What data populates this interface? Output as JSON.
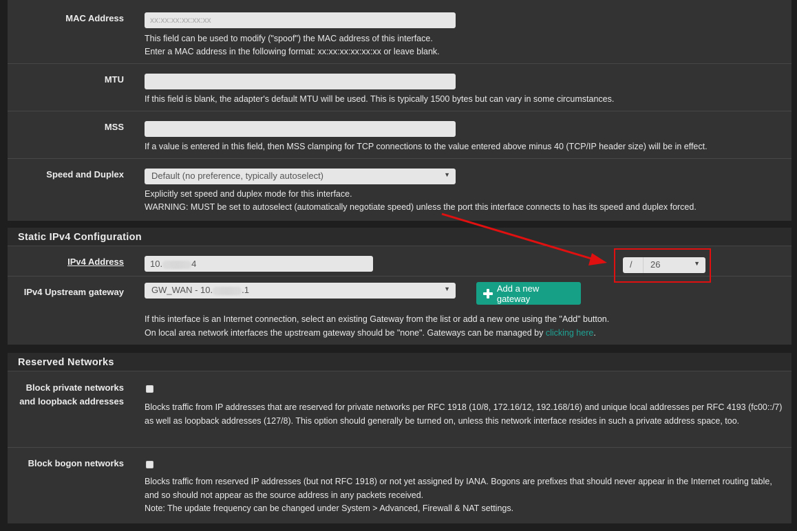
{
  "interface": {
    "mac": {
      "label": "MAC Address",
      "placeholder": "xx:xx:xx:xx:xx:xx",
      "help1": "This field can be used to modify (\"spoof\") the MAC address of this interface.",
      "help2": "Enter a MAC address in the following format: xx:xx:xx:xx:xx:xx or leave blank."
    },
    "mtu": {
      "label": "MTU",
      "value": "",
      "help": "If this field is blank, the adapter's default MTU will be used. This is typically 1500 bytes but can vary in some circumstances."
    },
    "mss": {
      "label": "MSS",
      "value": "",
      "help": "If a value is entered in this field, then MSS clamping for TCP connections to the value entered above minus 40 (TCP/IP header size) will be in effect."
    },
    "speed": {
      "label": "Speed and Duplex",
      "selected": "Default (no preference, typically autoselect)",
      "help1": "Explicitly set speed and duplex mode for this interface.",
      "help2": "WARNING: MUST be set to autoselect (automatically negotiate speed) unless the port this interface connects to has its speed and duplex forced."
    }
  },
  "static_ipv4": {
    "heading": "Static IPv4 Configuration",
    "address": {
      "label": "IPv4 Address",
      "value_prefix": "10.",
      "value_suffix": "4",
      "cidr_slash": "/",
      "cidr_value": "26"
    },
    "gateway": {
      "label": "IPv4 Upstream gateway",
      "selected_prefix": "GW_WAN - 10.",
      "selected_suffix": ".1",
      "add_button": "Add a new gateway",
      "help1": "If this interface is an Internet connection, select an existing Gateway from the list or add a new one using the \"Add\" button.",
      "help2_prefix": "On local area network interfaces the upstream gateway should be \"none\". Gateways can be managed by ",
      "help2_link": "clicking here",
      "help2_suffix": "."
    }
  },
  "reserved": {
    "heading": "Reserved Networks",
    "private": {
      "label_line1": "Block private networks",
      "label_line2": "and loopback addresses",
      "checked": false,
      "help": "Blocks traffic from IP addresses that are reserved for private networks per RFC 1918 (10/8, 172.16/12, 192.168/16) and unique local addresses per RFC 4193 (fc00::/7) as well as loopback addresses (127/8). This option should generally be turned on, unless this network interface resides in such a private address space, too."
    },
    "bogon": {
      "label": "Block bogon networks",
      "checked": false,
      "help1": "Blocks traffic from reserved IP addresses (but not RFC 1918) or not yet assigned by IANA. Bogons are prefixes that should never appear in the Internet routing table, and so should not appear as the source address in any packets received.",
      "help2": "Note: The update frequency can be changed under System > Advanced, Firewall & NAT settings."
    }
  },
  "colors": {
    "accent": "#16a085",
    "link": "#1fa294",
    "annotation": "#e01010"
  },
  "icons": {
    "add_button_icon": "plus-icon",
    "select_caret": "caret-down-icon"
  }
}
